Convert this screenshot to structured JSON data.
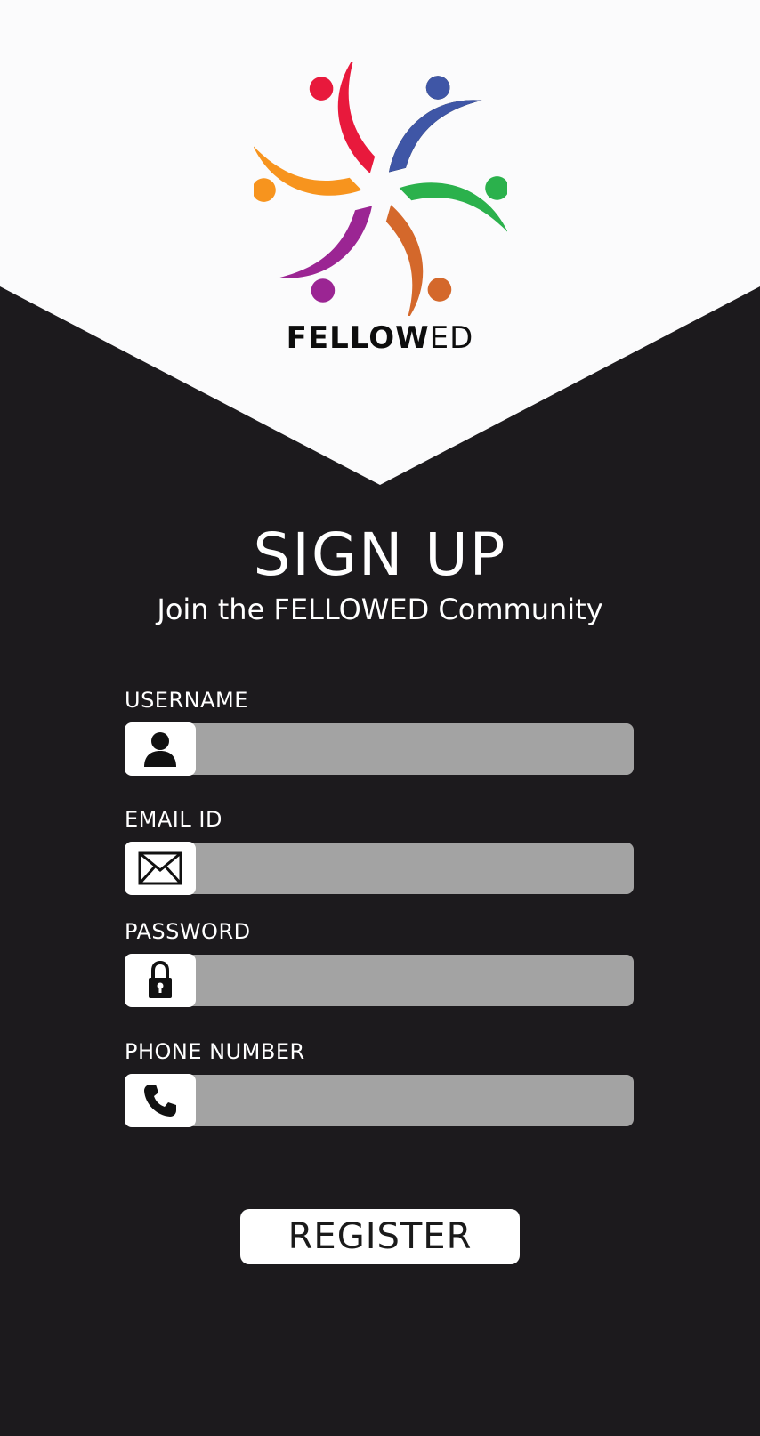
{
  "brand": {
    "name_bold": "FELLOW",
    "name_light": "ED"
  },
  "header": {
    "title": "SIGN UP",
    "subtitle": "Join the FELLOWED Community"
  },
  "form": {
    "username": {
      "label": "USERNAME",
      "icon": "user-icon",
      "value": ""
    },
    "email": {
      "label": "EMAIL ID",
      "icon": "envelope-icon",
      "value": ""
    },
    "password": {
      "label": "PASSWORD",
      "icon": "lock-icon",
      "value": ""
    },
    "phone": {
      "label": "PHONE NUMBER",
      "icon": "phone-icon",
      "value": ""
    }
  },
  "actions": {
    "register_label": "REGISTER"
  },
  "colors": {
    "background": "#1c1a1d",
    "hero": "#fbfbfc",
    "field": "#a3a3a3",
    "logo_red": "#e8193c",
    "logo_blue": "#3f56a6",
    "logo_green": "#2bb14c",
    "logo_orange": "#f7941e",
    "logo_purple": "#9b2593",
    "logo_rust": "#d4682b"
  }
}
